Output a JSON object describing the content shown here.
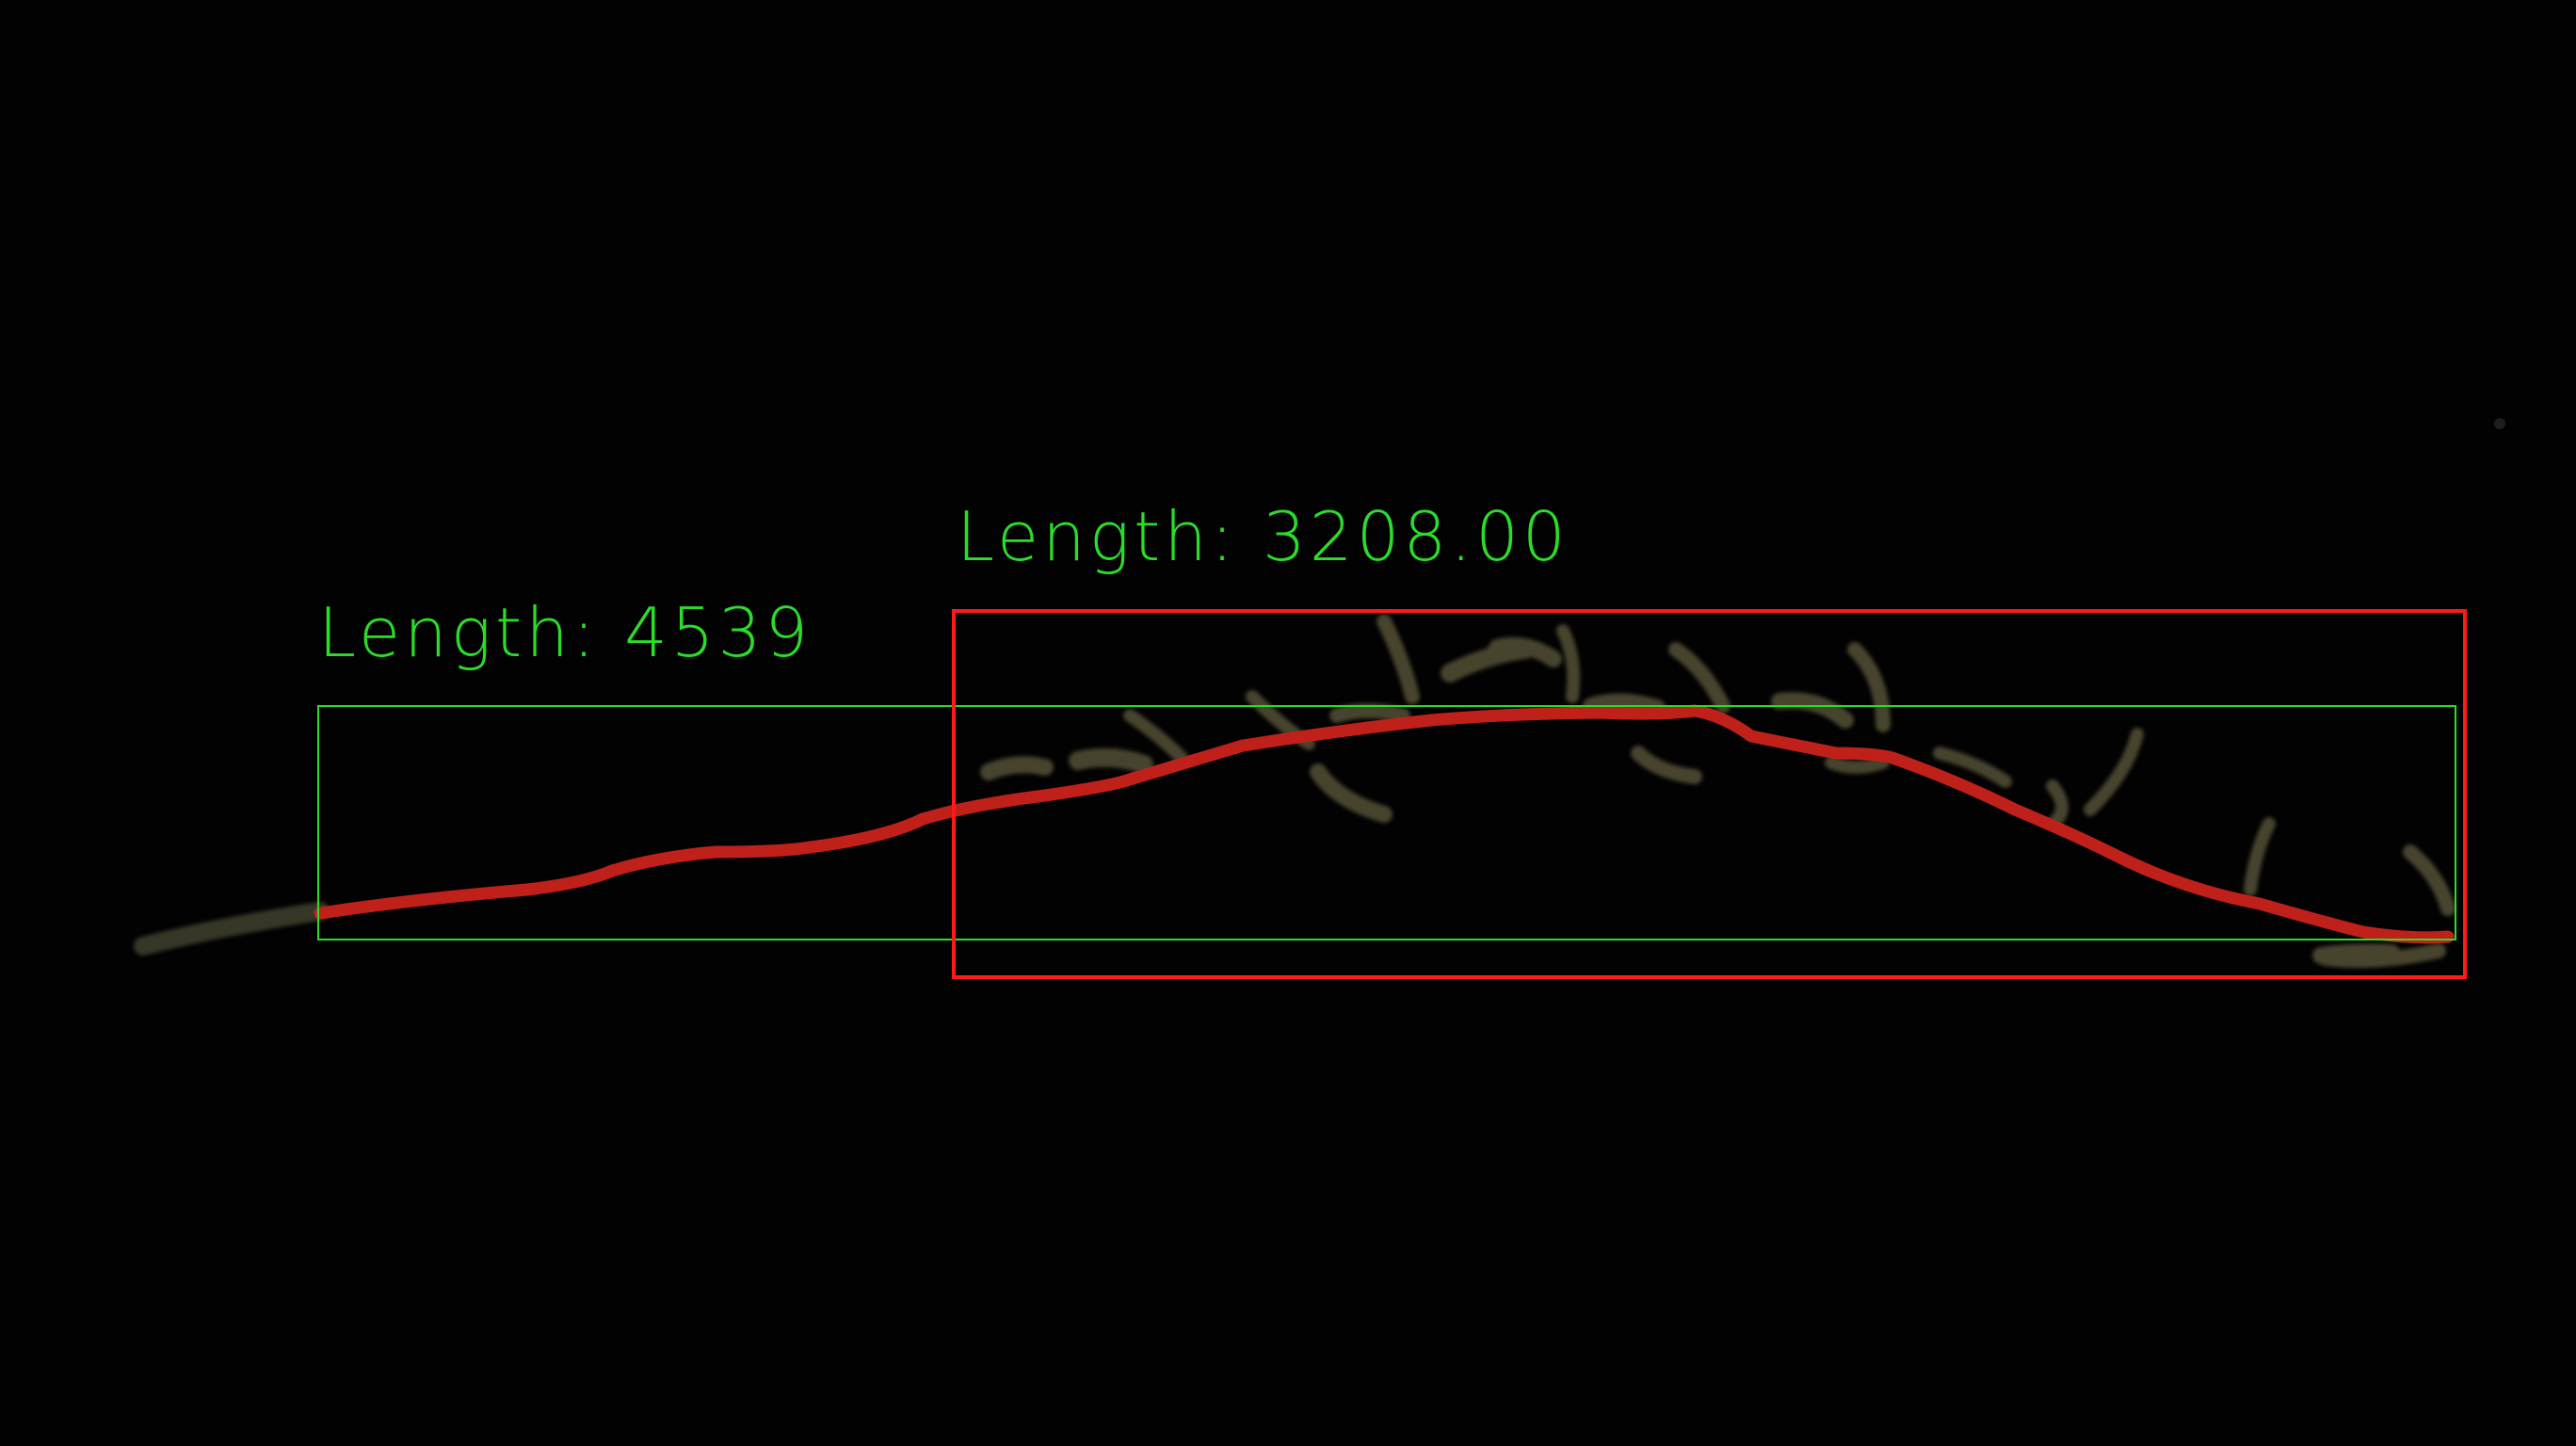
{
  "measurements": [
    {
      "id": "red-box-measurement",
      "label": "Length: 3208.00",
      "color": "#ff1a1a"
    },
    {
      "id": "green-box-measurement",
      "label": "Length: 4539",
      "color": "#2bdc2b"
    }
  ],
  "colors": {
    "background": "#020202",
    "root_trace": "#c0201a",
    "plant_tissue": "#6f6a4a",
    "red_box": "#ff1a1a",
    "green_box": "#2bdc2b",
    "label_text": "#2bdc2b"
  }
}
